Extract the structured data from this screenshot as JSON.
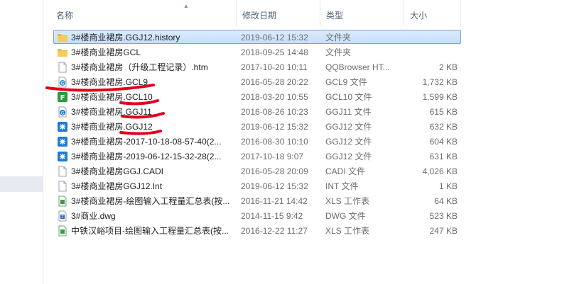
{
  "header": {
    "col_name": "名称",
    "col_date": "修改日期",
    "col_type": "类型",
    "col_size": "大小"
  },
  "files": [
    {
      "name": "3#楼商业裙房.GGJ12.history",
      "date": "2019-06-12 15:32",
      "type": "文件夹",
      "size": "",
      "icon": "folder-icon",
      "selected": true
    },
    {
      "name": "3#楼商业裙房GCL",
      "date": "2018-09-25 14:48",
      "type": "文件夹",
      "size": "",
      "icon": "folder-icon"
    },
    {
      "name": "3#楼商业裙房（升级工程记录）.htm",
      "date": "2017-10-20 10:11",
      "type": "QQBrowser HT...",
      "size": "2 KB",
      "icon": "htm-file-icon"
    },
    {
      "name": "3#楼商业裙房.GCL9",
      "date": "2016-05-28 20:22",
      "type": "GCL9 文件",
      "size": "1,732 KB",
      "icon": "gcl9-file-icon"
    },
    {
      "name": "3#楼商业裙房.GCL10",
      "date": "2018-03-20 10:55",
      "type": "GCL10 文件",
      "size": "1,599 KB",
      "icon": "gcl10-file-icon"
    },
    {
      "name": "3#楼商业裙房.GGJ11",
      "date": "2016-08-26 10:23",
      "type": "GGJ11 文件",
      "size": "615 KB",
      "icon": "ggj11-file-icon"
    },
    {
      "name": "3#楼商业裙房.GGJ12",
      "date": "2019-06-12 15:32",
      "type": "GGJ12 文件",
      "size": "632 KB",
      "icon": "ggj12-file-icon"
    },
    {
      "name": "3#楼商业裙房-2017-10-18-08-57-40(2...",
      "date": "2016-08-30 10:10",
      "type": "GGJ12 文件",
      "size": "604 KB",
      "icon": "ggj12-file-icon"
    },
    {
      "name": "3#楼商业裙房-2019-06-12-15-32-28(2...",
      "date": "2017-10-18 9:07",
      "type": "GGJ12 文件",
      "size": "631 KB",
      "icon": "ggj12-file-icon"
    },
    {
      "name": "3#楼商业裙房GGJ.CADI",
      "date": "2016-05-28 20:09",
      "type": "CADI 文件",
      "size": "4,026 KB",
      "icon": "blank-file-icon"
    },
    {
      "name": "3#楼商业裙房GGJ12.Int",
      "date": "2019-06-12 15:32",
      "type": "INT 文件",
      "size": "1 KB",
      "icon": "blank-file-icon"
    },
    {
      "name": "3#楼商业裙房-绘图输入工程量汇总表(按...",
      "date": "2016-11-21 14:42",
      "type": "XLS 工作表",
      "size": "64 KB",
      "icon": "xls-file-icon"
    },
    {
      "name": "3#商业.dwg",
      "date": "2014-11-15 9:42",
      "type": "DWG 文件",
      "size": "523 KB",
      "icon": "dwg-file-icon"
    },
    {
      "name": "中铁汉峪项目-绘图输入工程量汇总表(按...",
      "date": "2016-12-22 11:27",
      "type": "XLS 工作表",
      "size": "247 KB",
      "icon": "xls-file-icon"
    }
  ],
  "colors": {
    "selection": "#cce4fc",
    "annotation": "#e0001b",
    "header_text": "#4c607a"
  }
}
